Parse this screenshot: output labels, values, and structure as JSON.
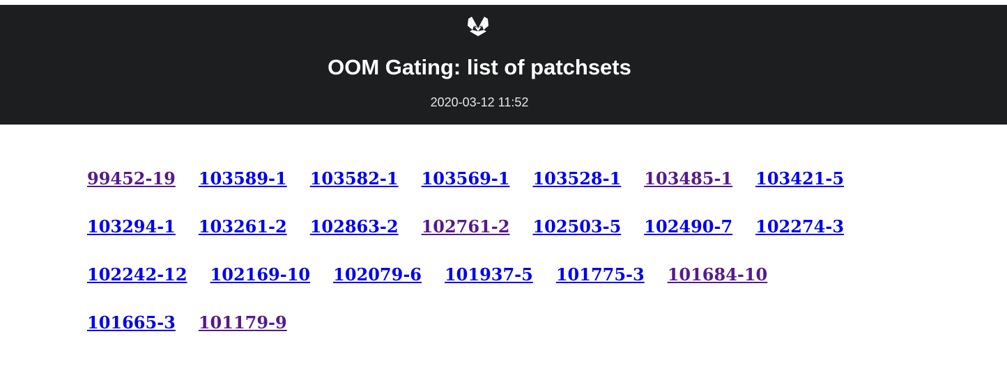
{
  "header": {
    "logo_icon": "gitlab-fox-icon",
    "title": "OOM Gating: list of patchsets",
    "timestamp": "2020-03-12 11:52"
  },
  "colors": {
    "header_bg": "#1d1e20",
    "link": "#0000ee",
    "visited_link": "#551a8b"
  },
  "patchsets": {
    "rows": [
      [
        {
          "label": "99452-19",
          "visited": true
        },
        {
          "label": "103589-1",
          "visited": false
        },
        {
          "label": "103582-1",
          "visited": false
        },
        {
          "label": "103569-1",
          "visited": false
        },
        {
          "label": "103528-1",
          "visited": false
        },
        {
          "label": "103485-1",
          "visited": true
        },
        {
          "label": "103421-5",
          "visited": false
        }
      ],
      [
        {
          "label": "103294-1",
          "visited": false
        },
        {
          "label": "103261-2",
          "visited": false
        },
        {
          "label": "102863-2",
          "visited": false
        },
        {
          "label": "102761-2",
          "visited": true
        },
        {
          "label": "102503-5",
          "visited": false
        },
        {
          "label": "102490-7",
          "visited": false
        },
        {
          "label": "102274-3",
          "visited": false
        }
      ],
      [
        {
          "label": "102242-12",
          "visited": false
        },
        {
          "label": "102169-10",
          "visited": false
        },
        {
          "label": "102079-6",
          "visited": false
        },
        {
          "label": "101937-5",
          "visited": false
        },
        {
          "label": "101775-3",
          "visited": false
        },
        {
          "label": "101684-10",
          "visited": true
        }
      ],
      [
        {
          "label": "101665-3",
          "visited": false
        },
        {
          "label": "101179-9",
          "visited": true
        }
      ]
    ]
  }
}
